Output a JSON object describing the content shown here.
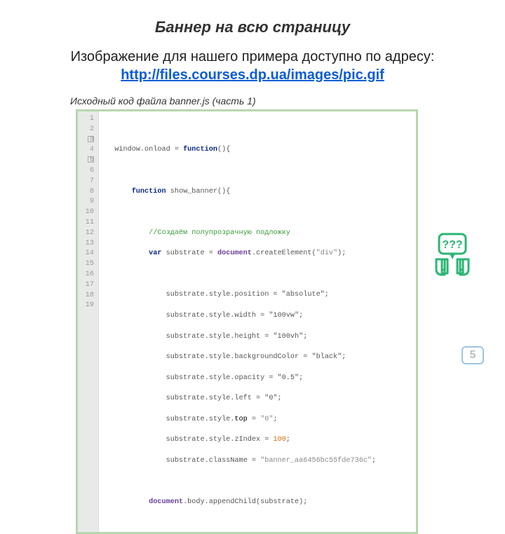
{
  "title": "Баннер на всю страницу",
  "subtitle_lead": "Изображение для нашего примера доступно по адресу: ",
  "subtitle_url": "http://files.courses.dp.ua/images/pic.gif",
  "code_caption": "Исходный код файла banner.js (часть 1)",
  "line_numbers": [
    "1",
    "2",
    "3",
    "4",
    "5",
    "6",
    "7",
    "8",
    "9",
    "10",
    "11",
    "12",
    "13",
    "14",
    "15",
    "16",
    "17",
    "18",
    "19"
  ],
  "code": {
    "l2_window": "window",
    "l2_onload": ".onload = ",
    "l2_function": "function",
    "l2_rest": "(){",
    "l4_function": "function",
    "l4_rest": " show_banner(){",
    "l6_comment": "//Создаём полупрозрачную подложку",
    "l7_var": "var",
    "l7_mid": " substrate = ",
    "l7_doc": "document",
    "l7_rest": ".createElement(",
    "l7_str": "\"div\"",
    "l7_end": ");",
    "l9": "substrate.style.position = \"absolute\";",
    "l10": "substrate.style.width = \"100vw\";",
    "l11": "substrate.style.height = \"100vh\";",
    "l12": "substrate.style.backgroundColor = \"black\";",
    "l13": "substrate.style.opacity = \"0.5\";",
    "l14": "substrate.style.left = \"0\";",
    "l15_a": "substrate.style.",
    "l15_top": "top",
    "l15_b": " = ",
    "l15_str": "\"0\"",
    "l15_c": ";",
    "l16_a": "substrate.style.zIndex = ",
    "l16_num": "100",
    "l16_b": ";",
    "l17_a": "substrate.className = ",
    "l17_str": "\"banner_aa6456bc55fde736c\"",
    "l17_b": ";",
    "l19_doc": "document",
    "l19_rest": ".body.appendChild(substrate);"
  },
  "question_text": "???",
  "page_number": "5",
  "colors": {
    "accent_green": "#2bb673",
    "title_link": "#0b5cd6",
    "code_border": "#b7d7b0"
  }
}
